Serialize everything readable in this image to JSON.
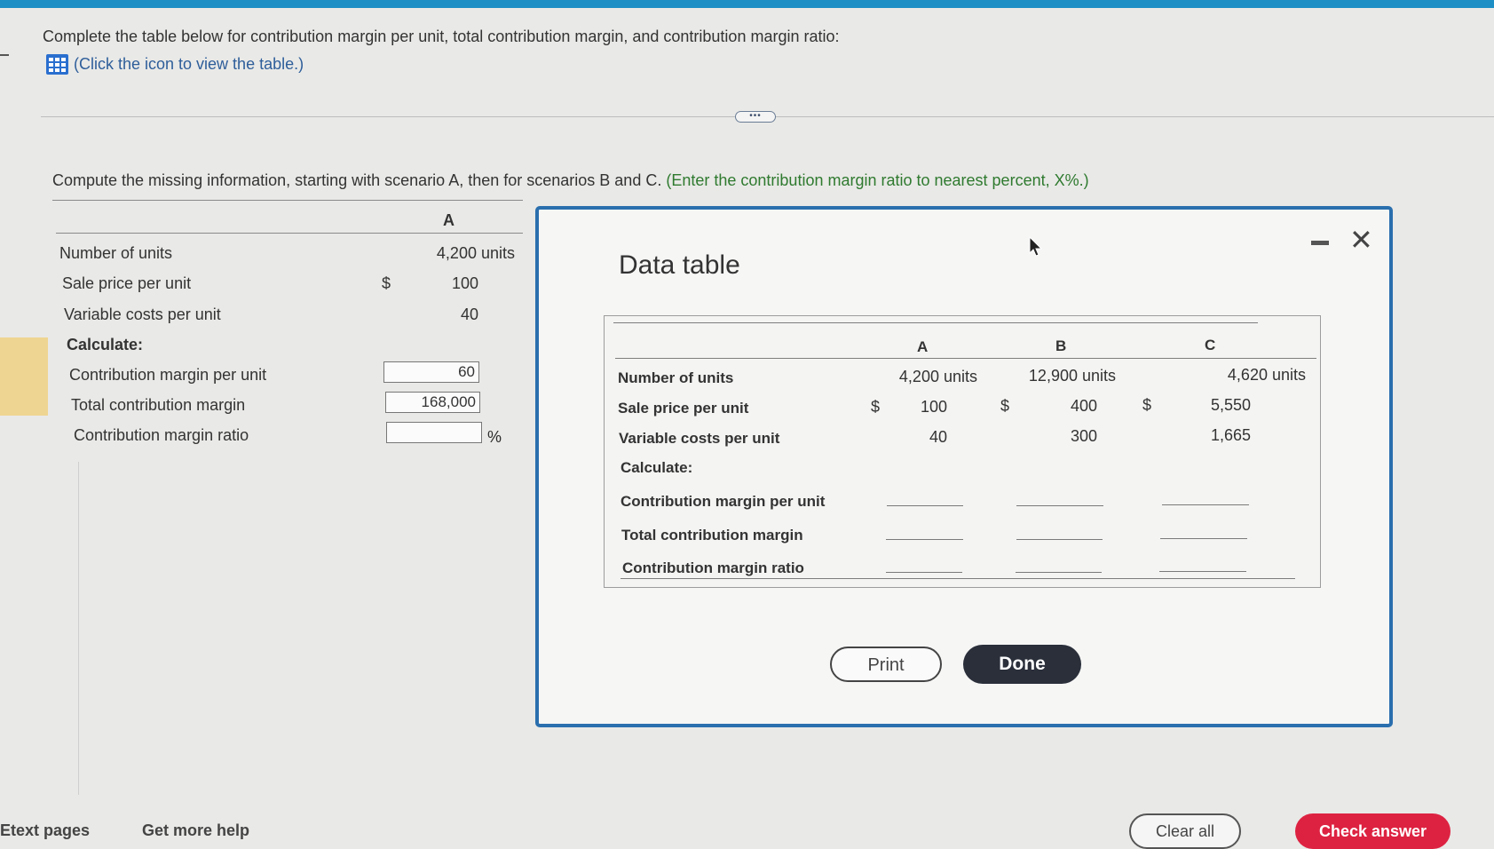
{
  "question": {
    "intro": "Complete the table below for contribution margin per unit, total contribution margin, and contribution margin ratio:",
    "view_table_link": "(Click the icon to view the table.)",
    "instruction_main": "Compute the missing information, starting with scenario A, then for scenarios B and C.",
    "instruction_hint": "(Enter the contribution margin ratio to nearest percent, X%.)"
  },
  "answer_table": {
    "column_header": "A",
    "rows": {
      "units_label": "Number of units",
      "units_value": "4,200 units",
      "price_label": "Sale price per unit",
      "price_currency": "$",
      "price_value": "100",
      "varcost_label": "Variable costs per unit",
      "varcost_value": "40",
      "calculate_label": "Calculate:",
      "cm_unit_label": "Contribution margin per unit",
      "cm_unit_value": "60",
      "total_cm_label": "Total contribution margin",
      "total_cm_value": "168,000",
      "cm_ratio_label": "Contribution margin ratio",
      "cm_ratio_value": "",
      "cm_ratio_unit": "%"
    }
  },
  "data_table": {
    "title": "Data table",
    "headers": {
      "a": "A",
      "b": "B",
      "c": "C"
    },
    "labels": {
      "units": "Number of units",
      "price": "Sale price per unit",
      "varcost": "Variable costs per unit",
      "calculate": "Calculate:",
      "cm_unit": "Contribution margin per unit",
      "total_cm": "Total contribution margin",
      "cm_ratio": "Contribution margin ratio"
    },
    "currency": "$",
    "a": {
      "units": "4,200 units",
      "price": "100",
      "varcost": "40"
    },
    "b": {
      "units": "12,900 units",
      "price": "400",
      "varcost": "300"
    },
    "c": {
      "units": "4,620 units",
      "price": "5,550",
      "varcost": "1,665"
    },
    "print_label": "Print",
    "done_label": "Done"
  },
  "footer": {
    "etext": "Etext pages",
    "help": "Get more help",
    "clear": "Clear all",
    "check": "Check answer"
  },
  "colors": {
    "top_bar": "#1d8fc4",
    "modal_border": "#2a6fae",
    "hint_text": "#2f7a2f",
    "check_button": "#dd2241",
    "done_button": "#2a2f3a"
  }
}
